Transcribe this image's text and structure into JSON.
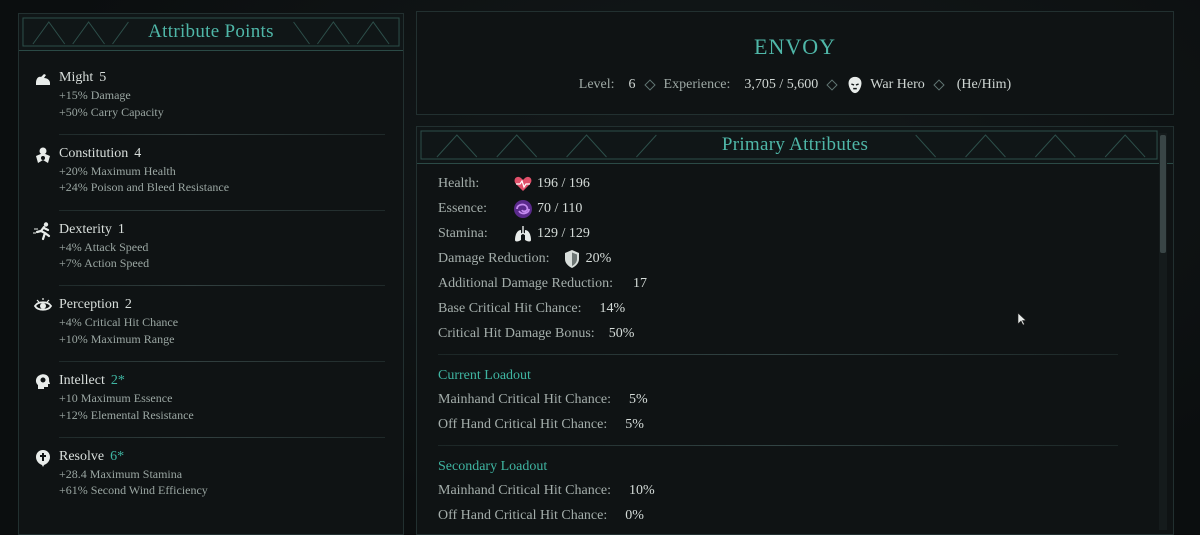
{
  "left_panel": {
    "title": "Attribute Points",
    "attributes": [
      {
        "icon": "might-icon",
        "name": "Might",
        "value": "5",
        "bonus": false,
        "effects": [
          "+15% Damage",
          "+50% Carry Capacity"
        ]
      },
      {
        "icon": "constitution-icon",
        "name": "Constitution",
        "value": "4",
        "bonus": false,
        "effects": [
          "+20% Maximum Health",
          "+24% Poison and Bleed Resistance"
        ]
      },
      {
        "icon": "dexterity-icon",
        "name": "Dexterity",
        "value": "1",
        "bonus": false,
        "effects": [
          "+4% Attack Speed",
          "+7% Action Speed"
        ]
      },
      {
        "icon": "perception-icon",
        "name": "Perception",
        "value": "2",
        "bonus": false,
        "effects": [
          "+4% Critical Hit Chance",
          "+10% Maximum Range"
        ]
      },
      {
        "icon": "intellect-icon",
        "name": "Intellect",
        "value": "2*",
        "bonus": true,
        "effects": [
          "+10 Maximum Essence",
          "+12% Elemental Resistance"
        ]
      },
      {
        "icon": "resolve-icon",
        "name": "Resolve",
        "value": "6*",
        "bonus": true,
        "effects": [
          "+28.4 Maximum Stamina",
          "+61% Second Wind Efficiency"
        ]
      }
    ]
  },
  "character": {
    "name": "ENVOY",
    "level_label": "Level:",
    "level": "6",
    "experience_label": "Experience:",
    "experience": "3,705 / 5,600",
    "background": "War Hero",
    "pronouns": "(He/Him)"
  },
  "primary": {
    "title": "Primary Attributes",
    "health_label": "Health:",
    "health": "196 / 196",
    "essence_label": "Essence:",
    "essence": "70 / 110",
    "stamina_label": "Stamina:",
    "stamina": "129 / 129",
    "damage_reduction_label": "Damage Reduction:",
    "damage_reduction": "20%",
    "additional_dr_label": "Additional Damage Reduction:",
    "additional_dr": "17",
    "base_crit_label": "Base Critical Hit Chance:",
    "base_crit": "14%",
    "crit_damage_label": "Critical Hit Damage Bonus:",
    "crit_damage": "50%"
  },
  "current_loadout": {
    "title": "Current Loadout",
    "mainhand_label": "Mainhand Critical Hit Chance:",
    "mainhand": "5%",
    "offhand_label": "Off Hand Critical Hit Chance:",
    "offhand": "5%"
  },
  "secondary_loadout": {
    "title": "Secondary Loadout",
    "mainhand_label": "Mainhand Critical Hit Chance:",
    "mainhand": "10%",
    "offhand_label": "Off Hand Critical Hit Chance:",
    "offhand": "0%"
  },
  "colors": {
    "accent": "#4fb7a8",
    "bonus": "#3fb5a2",
    "health": "#e0506a",
    "essence": "#9b4fd6"
  }
}
